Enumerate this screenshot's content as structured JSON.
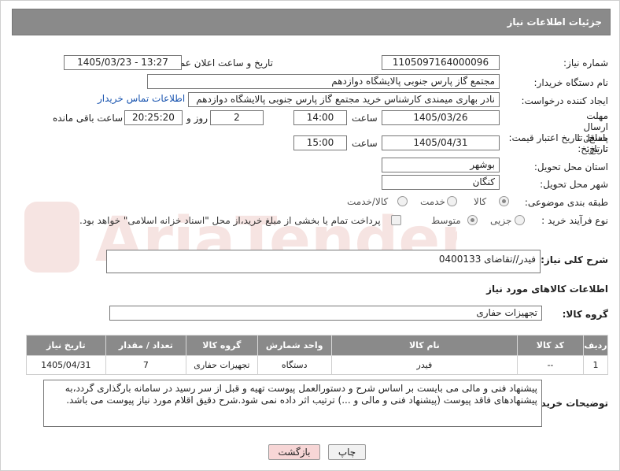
{
  "header": {
    "title": "جزئیات اطلاعات نیاز"
  },
  "fields": {
    "need_number_label": "شماره نیاز:",
    "need_number": "1105097164000096",
    "announce_label": "تاریخ و ساعت اعلان عمومی:",
    "announce_value": "1405/03/23 - 13:27",
    "buyer_label": "نام دستگاه خریدار:",
    "buyer_value": "مجتمع گاز پارس جنوبی  پالایشگاه دوازدهم",
    "creator_label": "ایجاد کننده درخواست:",
    "creator_value": "نادر بهاری میمندی کارشناس خرید مجتمع گاز پارس جنوبی  پالایشگاه دوازدهم",
    "contact_link": "اطلاعات تماس خریدار",
    "reply_deadline_label": "مهلت ارسال پاسخ: تا تاریخ:",
    "reply_date": "1405/03/26",
    "time_word": "ساعت",
    "reply_time": "14:00",
    "days_value": "2",
    "days_word": "روز و",
    "remaining_time": "20:25:20",
    "remaining_word": "ساعت باقی مانده",
    "price_deadline_label": "حداقل تاریخ اعتبار قیمت: تا تاریخ:",
    "price_date": "1405/04/31",
    "price_time": "15:00",
    "province_label": "استان محل تحویل:",
    "province_value": "بوشهر",
    "city_label": "شهر محل تحویل:",
    "city_value": "کنگان",
    "category_label": "طبقه بندی موضوعی:",
    "category_options": [
      "کالا",
      "خدمت",
      "کالا/خدمت"
    ],
    "process_label": "نوع فرآیند خرید :",
    "process_options": [
      "جزیی",
      "متوسط"
    ],
    "payment_note": "پرداخت تمام یا بخشی از مبلغ خرید،از محل \"اسناد خزانه اسلامی\" خواهد بود."
  },
  "description": {
    "label": "شرح کلی نیاز:",
    "value": "فیدر//تقاضای 0400133"
  },
  "goods": {
    "section_title": "اطلاعات کالاهای مورد نیاز",
    "group_label": "گروه کالا:",
    "group_value": "تجهیزات حفاری",
    "columns": [
      "ردیف",
      "کد کالا",
      "نام کالا",
      "واحد شمارش",
      "گروه کالا",
      "تعداد / مقدار",
      "تاریخ نیاز"
    ],
    "rows": [
      [
        "1",
        "--",
        "فیدر",
        "دستگاه",
        "تجهیزات حفاری",
        "7",
        "1405/04/31"
      ]
    ]
  },
  "buyer_notes": {
    "label": "توضیحات خریدار:",
    "value": "پیشنهاد فنی و مالی می بایست بر اساس شرح و دستورالعمل پیوست تهیه و قبل از سر رسید در سامانه بارگذاری گردد،به پیشنهادهای فاقد پیوست (پیشنهاد فنی و مالی و ...) ترتیب اثر داده نمی شود.شرح دقیق اقلام مورد نیاز پیوست می باشد."
  },
  "buttons": {
    "print": "چاپ",
    "back": "بازگشت"
  },
  "watermark": {
    "text": "AriaTender.net"
  },
  "colors": {
    "header_bg": "#8a8a8a",
    "link": "#1a55b0",
    "back_button_bg": "#f7d6d6",
    "watermark": "#c0392b"
  }
}
